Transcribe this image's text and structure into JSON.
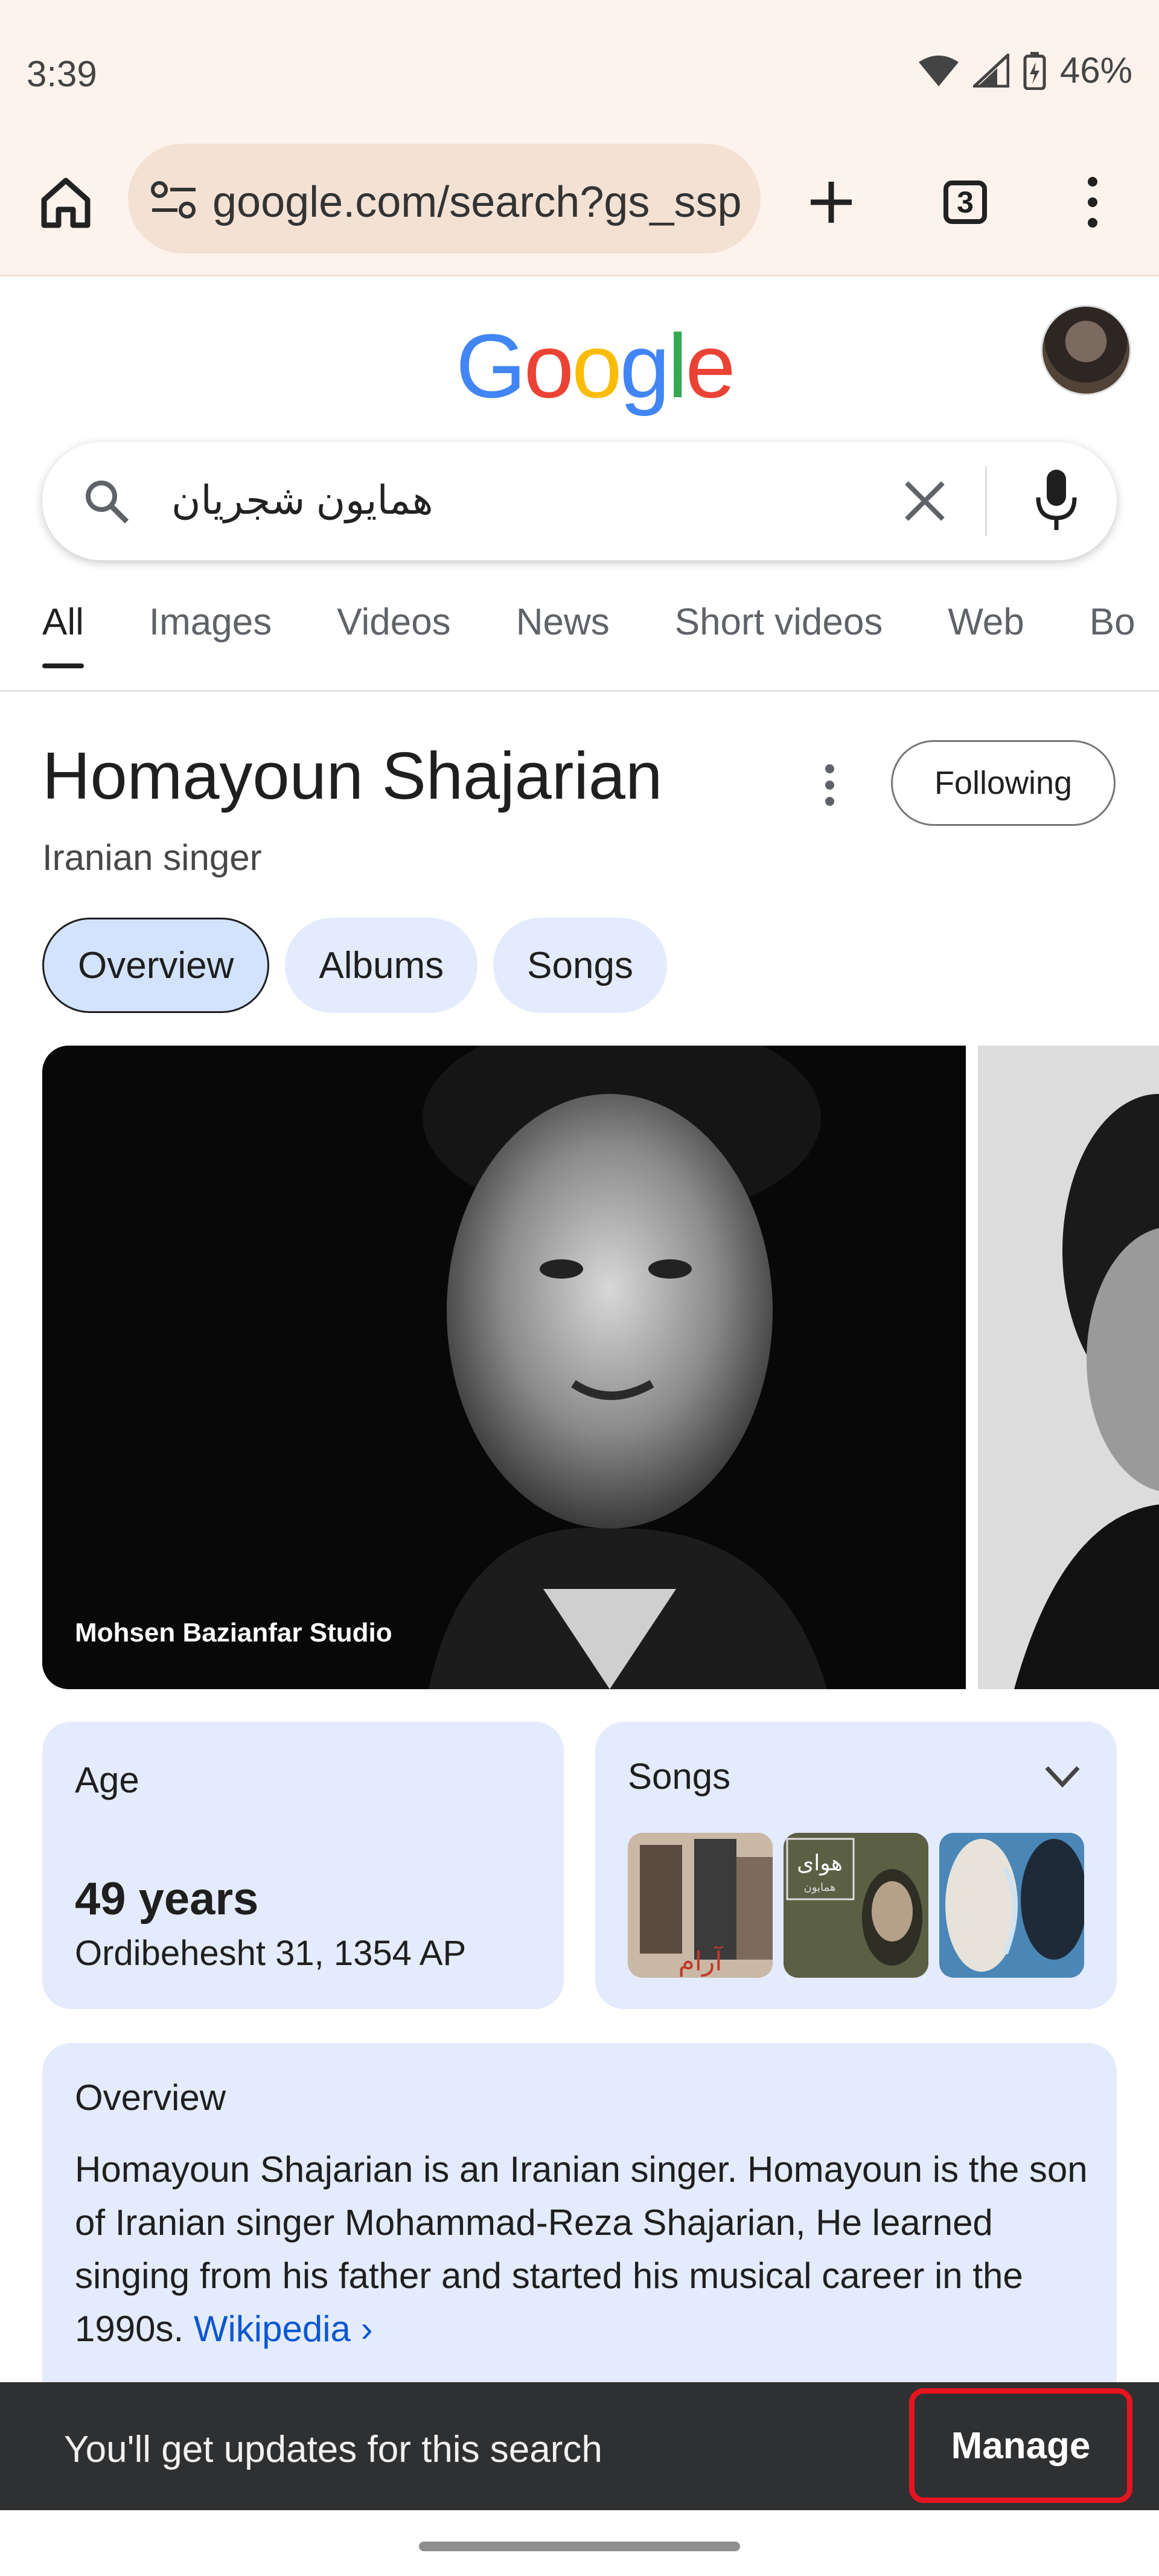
{
  "status_bar": {
    "time": "3:39",
    "battery": "46%"
  },
  "browser": {
    "url": "google.com/search?gs_ssp",
    "tab_count": "3"
  },
  "google": {
    "logo": [
      "G",
      "o",
      "o",
      "g",
      "l",
      "e"
    ],
    "logo_colors": [
      "#4285F4",
      "#EA4335",
      "#FBBC05",
      "#4285F4",
      "#34A853",
      "#EA4335"
    ]
  },
  "search": {
    "query": "همایون شجریان"
  },
  "tabs": [
    {
      "label": "All",
      "active": true
    },
    {
      "label": "Images"
    },
    {
      "label": "Videos"
    },
    {
      "label": "News"
    },
    {
      "label": "Short videos"
    },
    {
      "label": "Web"
    },
    {
      "label": "Bo"
    }
  ],
  "knowledge_panel": {
    "title": "Homayoun Shajarian",
    "subtitle": "Iranian singer",
    "following_label": "Following",
    "chips": [
      "Overview",
      "Albums",
      "Songs"
    ],
    "image_credit": "Mohsen Bazianfar Studio",
    "age": {
      "label": "Age",
      "value": "49 years",
      "date": "Ordibehesht 31, 1354 AP"
    },
    "songs": {
      "label": "Songs",
      "thumb_text": "هوای",
      "thumb_subtext": "همایون",
      "thumb_overlay": "آرام"
    },
    "overview": {
      "label": "Overview",
      "text": "Homayoun Shajarian is an Iranian singer. Homayoun is the son of Iranian singer Mohammad-Reza Shajarian, He learned singing from his father and started his musical career in the 1990s.",
      "link": "Wikipedia"
    }
  },
  "snackbar": {
    "text": "You'll get updates for this search",
    "action": "Manage"
  },
  "icons": [
    "home-icon",
    "tune-icon",
    "plus-icon",
    "tabs-icon",
    "more-vert-icon",
    "search-icon",
    "close-icon",
    "mic-icon",
    "chevron-down-icon",
    "wifi-icon",
    "signal-icon",
    "battery-icon"
  ]
}
